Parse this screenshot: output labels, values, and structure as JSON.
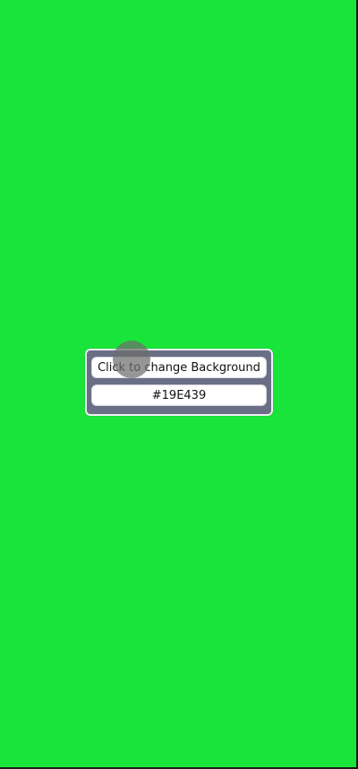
{
  "screen": {
    "background_color": "#19E439"
  },
  "panel": {
    "button_label": "Click to change Background",
    "hex_value": "#19E439"
  },
  "touch_indicator": {
    "visible": true
  }
}
